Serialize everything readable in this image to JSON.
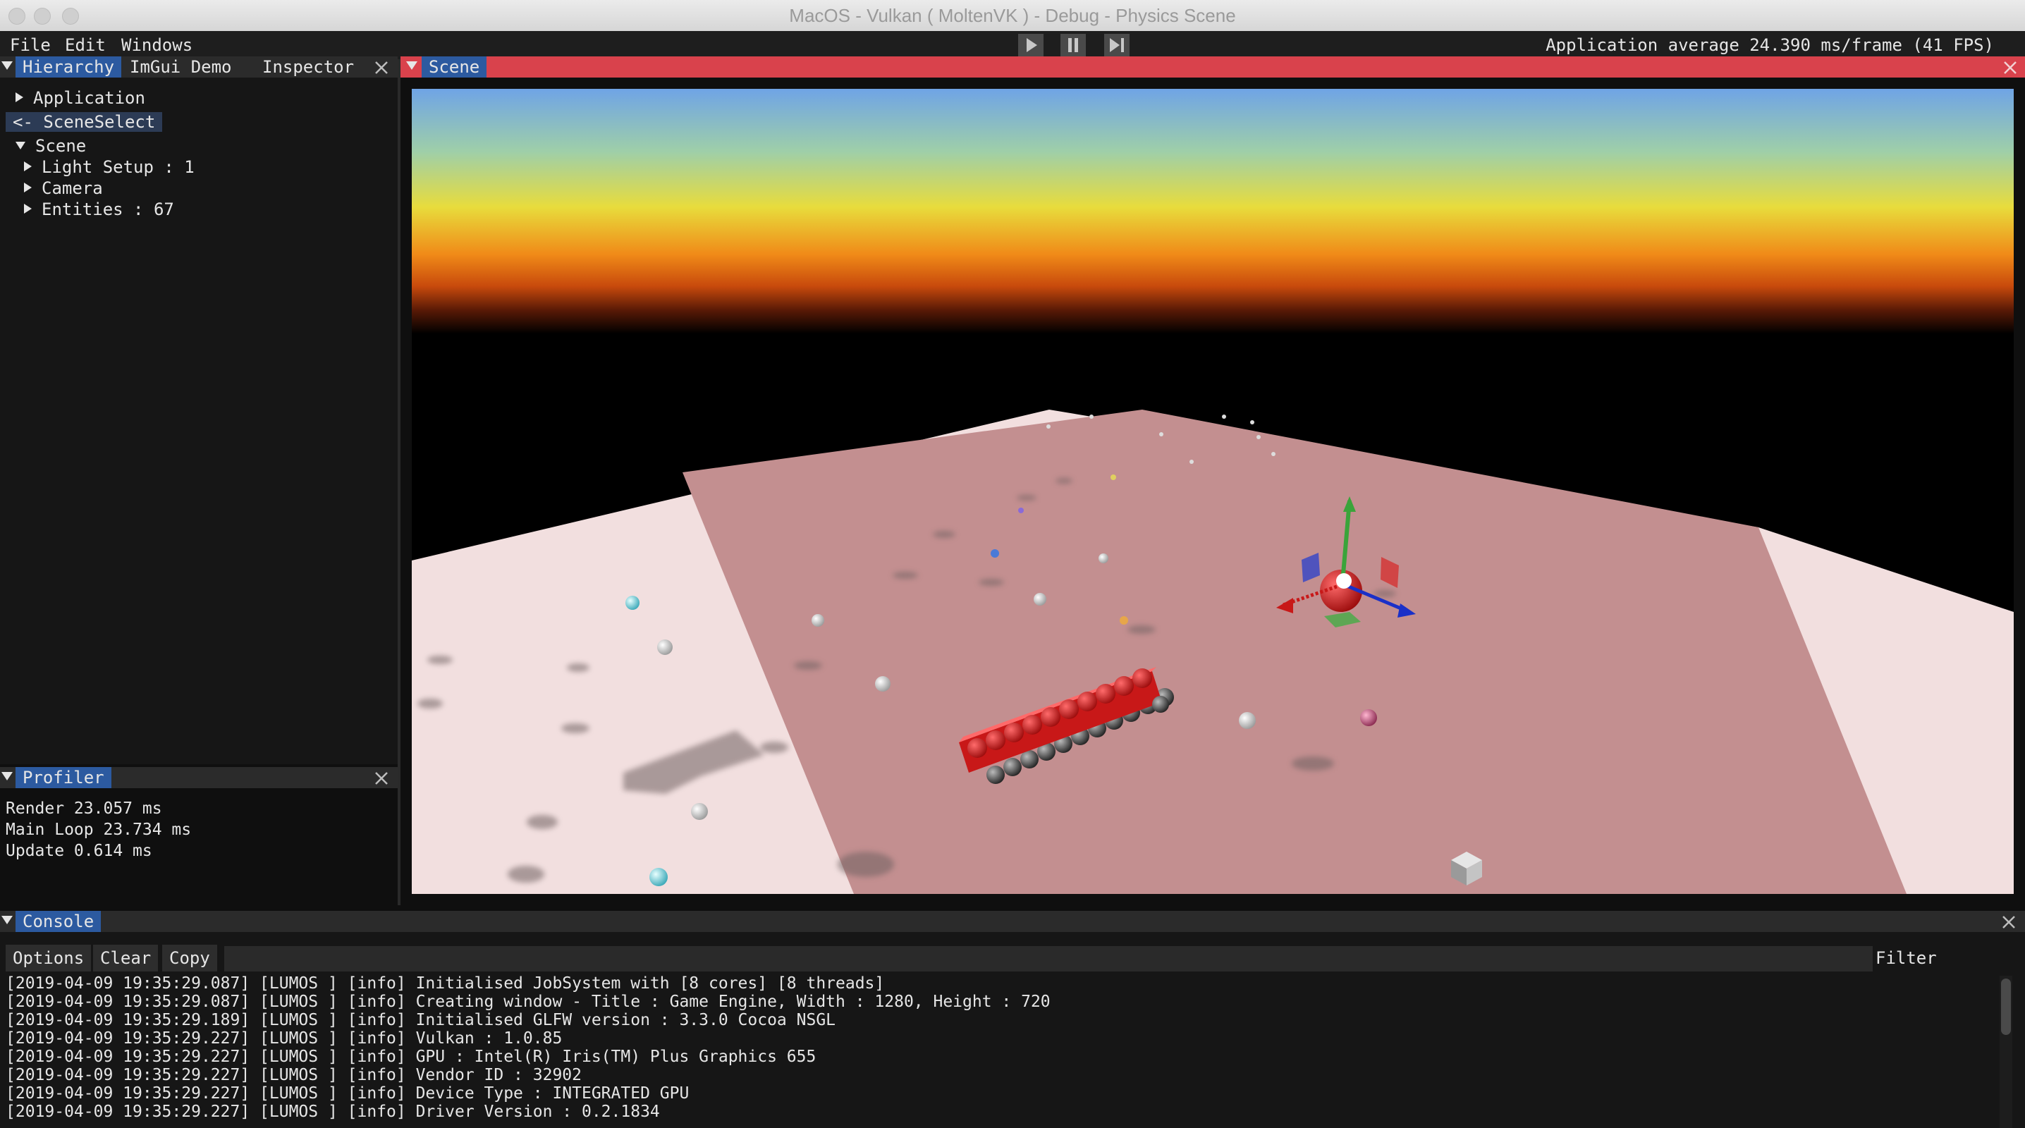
{
  "window": {
    "title": "MacOS - Vulkan ( MoltenVK ) - Debug - Physics Scene"
  },
  "menubar": {
    "items": [
      "File",
      "Edit",
      "Windows"
    ],
    "fps_text": "Application average 24.390 ms/frame (41 FPS)"
  },
  "hierarchy": {
    "tabs": [
      "Hierarchy",
      "ImGui Demo",
      "Inspector"
    ],
    "tree": {
      "application": "Application",
      "scene_select": "<- SceneSelect",
      "scene": "Scene",
      "light_setup": "Light Setup : 1",
      "camera": "Camera",
      "entities": "Entities : 67"
    }
  },
  "profiler": {
    "title": "Profiler",
    "rows": [
      "Render 23.057 ms",
      "Main Loop 23.734 ms",
      "Update 0.614 ms"
    ]
  },
  "scene": {
    "title": "Scene"
  },
  "console": {
    "title": "Console",
    "buttons": [
      "Options",
      "Clear",
      "Copy"
    ],
    "filter_label": "Filter",
    "lines": [
      "[2019-04-09 19:35:29.087] [LUMOS ] [info] Initialised JobSystem with [8 cores] [8 threads]",
      "[2019-04-09 19:35:29.087] [LUMOS ] [info] Creating window - Title : Game Engine, Width : 1280, Height : 720",
      "[2019-04-09 19:35:29.189] [LUMOS ] [info] Initialised GLFW version : 3.3.0 Cocoa NSGL",
      "[2019-04-09 19:35:29.227] [LUMOS ] [info] Vulkan : 1.0.85",
      "[2019-04-09 19:35:29.227] [LUMOS ] [info] GPU : Intel(R) Iris(TM) Plus Graphics 655",
      "[2019-04-09 19:35:29.227] [LUMOS ] [info] Vendor ID : 32902",
      "[2019-04-09 19:35:29.227] [LUMOS ] [info] Device Type : INTEGRATED GPU",
      "[2019-04-09 19:35:29.227] [LUMOS ] [info] Driver Version : 0.2.1834"
    ]
  },
  "colors": {
    "scene_header": "#d9424c",
    "active_tab": "#2c5aa0",
    "panel_bg": "#161616"
  }
}
